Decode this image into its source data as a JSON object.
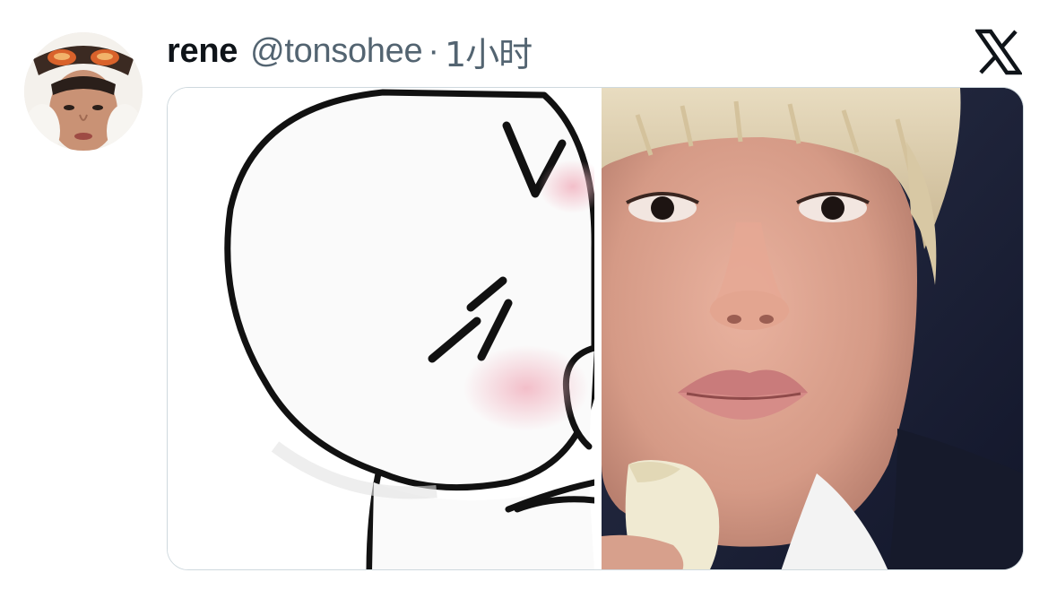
{
  "tweet": {
    "display_name": "rene",
    "handle": "@tonsohee",
    "separator": "·",
    "time": "1小时"
  },
  "icons": {
    "platform_logo": "x-logo-icon",
    "avatar": "profile-avatar-photo"
  },
  "media": [
    {
      "kind": "cartoon-sticker"
    },
    {
      "kind": "selfie-photo"
    }
  ],
  "colors": {
    "name": "#0f1419",
    "secondary_text": "#536471",
    "border": "#cfd9de",
    "background": "#ffffff"
  }
}
